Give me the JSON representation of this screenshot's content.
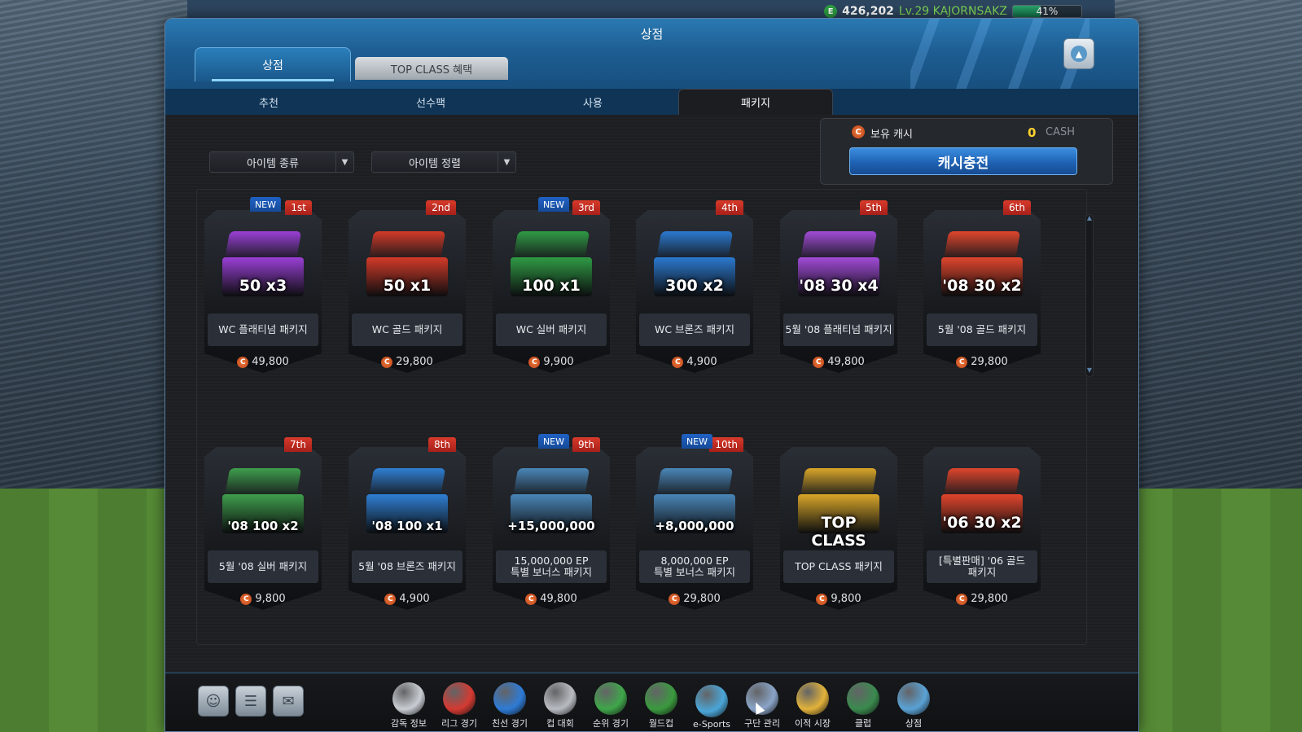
{
  "status": {
    "ep": "426,202",
    "level_name": "Lv.29 KAJORNSAKZ",
    "progress_label": "41%",
    "progress": 0.41
  },
  "window": {
    "title": "상점",
    "main_tabs": [
      {
        "label": "상점",
        "active": true
      },
      {
        "label": "TOP CLASS 혜택",
        "active": false
      }
    ],
    "sub_tabs": [
      {
        "label": "추천"
      },
      {
        "label": "선수팩"
      },
      {
        "label": "사용"
      },
      {
        "label": "패키지",
        "active": true
      }
    ]
  },
  "filters": {
    "type": "아이템 종류",
    "sort": "아이템 정렬"
  },
  "cash": {
    "label": "보유 캐시",
    "value": "0",
    "unit": "CASH",
    "charge_label": "캐시충전"
  },
  "items": [
    {
      "rank": "1st",
      "new": "NEW",
      "name": "WC 플래티넘 패키지",
      "price": "49,800",
      "art": "50 x3",
      "color": "#9a3fd6"
    },
    {
      "rank": "2nd",
      "new": "",
      "name": "WC 골드 패키지",
      "price": "29,800",
      "art": "50 x1",
      "color": "#d33a28"
    },
    {
      "rank": "3rd",
      "new": "NEW",
      "name": "WC 실버 패키지",
      "price": "9,900",
      "art": "100 x1",
      "color": "#2f9a44"
    },
    {
      "rank": "4th",
      "new": "",
      "name": "WC 브론즈 패키지",
      "price": "4,900",
      "art": "300 x2",
      "color": "#2b79d0"
    },
    {
      "rank": "5th",
      "new": "",
      "name": "5월 '08 플래티넘 패키지",
      "price": "49,800",
      "art": "'08 30 x4",
      "color": "#a24bd8"
    },
    {
      "rank": "6th",
      "new": "",
      "name": "5월 '08 골드 패키지",
      "price": "29,800",
      "art": "'08 30 x2",
      "color": "#e0452c"
    },
    {
      "rank": "7th",
      "new": "",
      "name": "5월 '08 실버 패키지",
      "price": "9,800",
      "art": "'08 100 x2",
      "color": "#3f9e4c"
    },
    {
      "rank": "8th",
      "new": "",
      "name": "5월 '08 브론즈 패키지",
      "price": "4,900",
      "art": "'08 100 x1",
      "color": "#2f7fd4"
    },
    {
      "rank": "9th",
      "new": "NEW",
      "name": "15,000,000 EP\n특별 보너스 패키지",
      "price": "49,800",
      "art": "+15,000,000",
      "color": "#4a86b8"
    },
    {
      "rank": "10th",
      "new": "NEW",
      "name": "8,000,000 EP\n특별 보너스 패키지",
      "price": "29,800",
      "art": "+8,000,000",
      "color": "#4a86b8"
    },
    {
      "rank": "",
      "new": "",
      "name": "TOP CLASS 패키지",
      "price": "9,800",
      "art": "TOP CLASS",
      "color": "#d9a628"
    },
    {
      "rank": "",
      "new": "",
      "name": "[특별판매] '06 골드\n패키지",
      "price": "29,800",
      "art": "'06 30 x2",
      "color": "#e0452c"
    }
  ],
  "bottom_menu": [
    {
      "label": "감독 정보",
      "icon": "whistle-icon",
      "color": "#c9ced4"
    },
    {
      "label": "리그 경기",
      "icon": "soccer-ball-icon",
      "color": "#d43a32"
    },
    {
      "label": "친선 경기",
      "icon": "boot-icon",
      "color": "#2e7bd6"
    },
    {
      "label": "컵 대회",
      "icon": "trophy-icon",
      "color": "#b8bcc2"
    },
    {
      "label": "순위 경기",
      "icon": "ranking-pyramid-icon",
      "color": "#3fa64a"
    },
    {
      "label": "월드컵",
      "icon": "worldcup-2014-icon",
      "color": "#3a9a3e"
    },
    {
      "label": "e-Sports",
      "icon": "esports-field-icon",
      "color": "#4aa6d8"
    },
    {
      "label": "구단 관리",
      "icon": "clipboard-icon",
      "color": "#8aa4c8"
    },
    {
      "label": "이적 시장",
      "icon": "jersey-icon",
      "color": "#e2b23a"
    },
    {
      "label": "클럽",
      "icon": "club-badge-icon",
      "color": "#3a8a4e"
    },
    {
      "label": "상점",
      "icon": "shopping-cart-icon",
      "color": "#5aa2d6"
    }
  ]
}
